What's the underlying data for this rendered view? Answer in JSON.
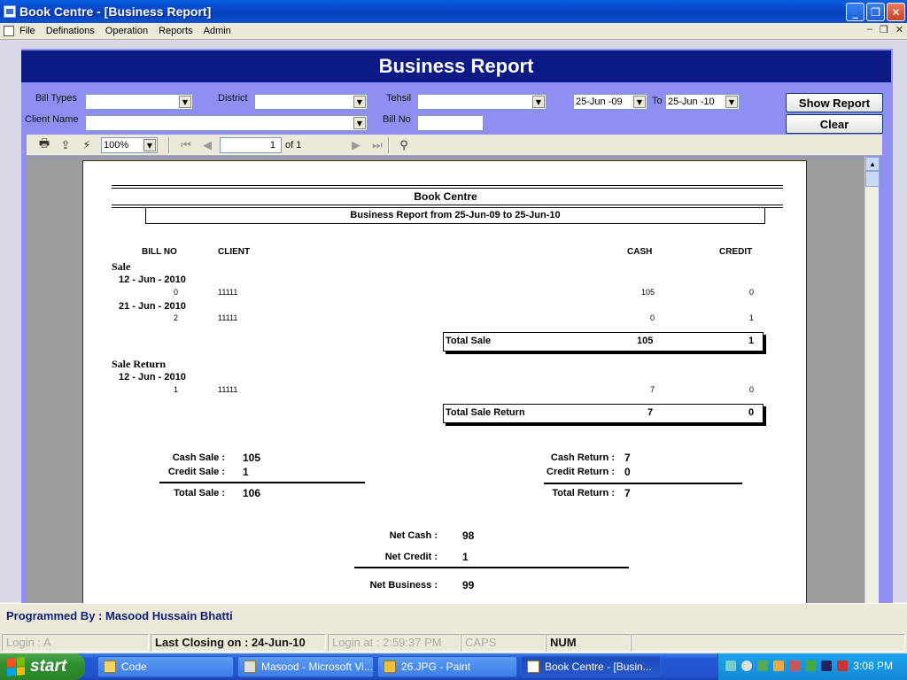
{
  "window": {
    "title": "Book Centre  - [Business Report]",
    "min": "_",
    "max": "❐",
    "close": "✕"
  },
  "menu": {
    "items": [
      "File",
      "Definations",
      "Operation",
      "Reports",
      "Admin"
    ],
    "mdi": [
      "–",
      "❐",
      "✕"
    ]
  },
  "form": {
    "header": "Business Report",
    "filters": {
      "bill_types_label": "Bill Types",
      "district_label": "District",
      "tehsil_label": "Tehsil",
      "client_name_label": "Client Name",
      "bill_no_label": "Bill No",
      "from_date": "25-Jun -09",
      "to_label": "To",
      "to_date": "25-Jun -10"
    },
    "buttons": {
      "show_report": "Show Report",
      "clear": "Clear"
    }
  },
  "viewer_toolbar": {
    "zoom": "100%",
    "page": "1",
    "of": "of 1"
  },
  "report": {
    "company": "Book Centre",
    "subtitle": "Business Report from 25-Jun-09 to 25-Jun-10",
    "columns": {
      "bill_no": "BILL NO",
      "client": "CLIENT",
      "cash": "CASH",
      "credit": "CREDIT"
    },
    "sale": {
      "label": "Sale",
      "groups": [
        {
          "date": "12 - Jun - 2010",
          "bill": "0",
          "client": "11111",
          "cash": "105",
          "credit": "0"
        },
        {
          "date": "21 - Jun - 2010",
          "bill": "2",
          "client": "11111",
          "cash": "0",
          "credit": "1"
        }
      ],
      "total_label": "Total  Sale",
      "total_cash": "105",
      "total_credit": "1"
    },
    "sale_return": {
      "label": "Sale Return",
      "groups": [
        {
          "date": "12 - Jun - 2010",
          "bill": "1",
          "client": "11111",
          "cash": "7",
          "credit": "0"
        }
      ],
      "total_label": "Total  Sale Return",
      "total_cash": "7",
      "total_credit": "0"
    },
    "summary": {
      "cash_sale_label": "Cash Sale :",
      "cash_sale": "105",
      "credit_sale_label": "Credit Sale :",
      "credit_sale": "1",
      "total_sale_label": "Total Sale :",
      "total_sale": "106",
      "cash_return_label": "Cash Return :",
      "cash_return": "7",
      "credit_return_label": "Credit Return :",
      "credit_return": "0",
      "total_return_label": "Total Return :",
      "total_return": "7",
      "net_cash_label": "Net Cash :",
      "net_cash": "98",
      "net_credit_label": "Net Credit :",
      "net_credit": "1",
      "net_business_label": "Net Business :",
      "net_business": "99"
    }
  },
  "footer": {
    "programmed_by": "Programmed By : Masood Hussain Bhatti"
  },
  "status": {
    "login": "Login :  A",
    "last_closing": "Last Closing on : 24-Jun-10",
    "login_at": "Login at : 2:59:37 PM",
    "caps": "CAPS",
    "num": "NUM"
  },
  "taskbar": {
    "start": "start",
    "buttons": [
      "Code",
      "Masood - Microsoft Vi...",
      "26.JPG - Paint",
      "Book Centre  - [Busin..."
    ],
    "clock": "3:08 PM"
  }
}
